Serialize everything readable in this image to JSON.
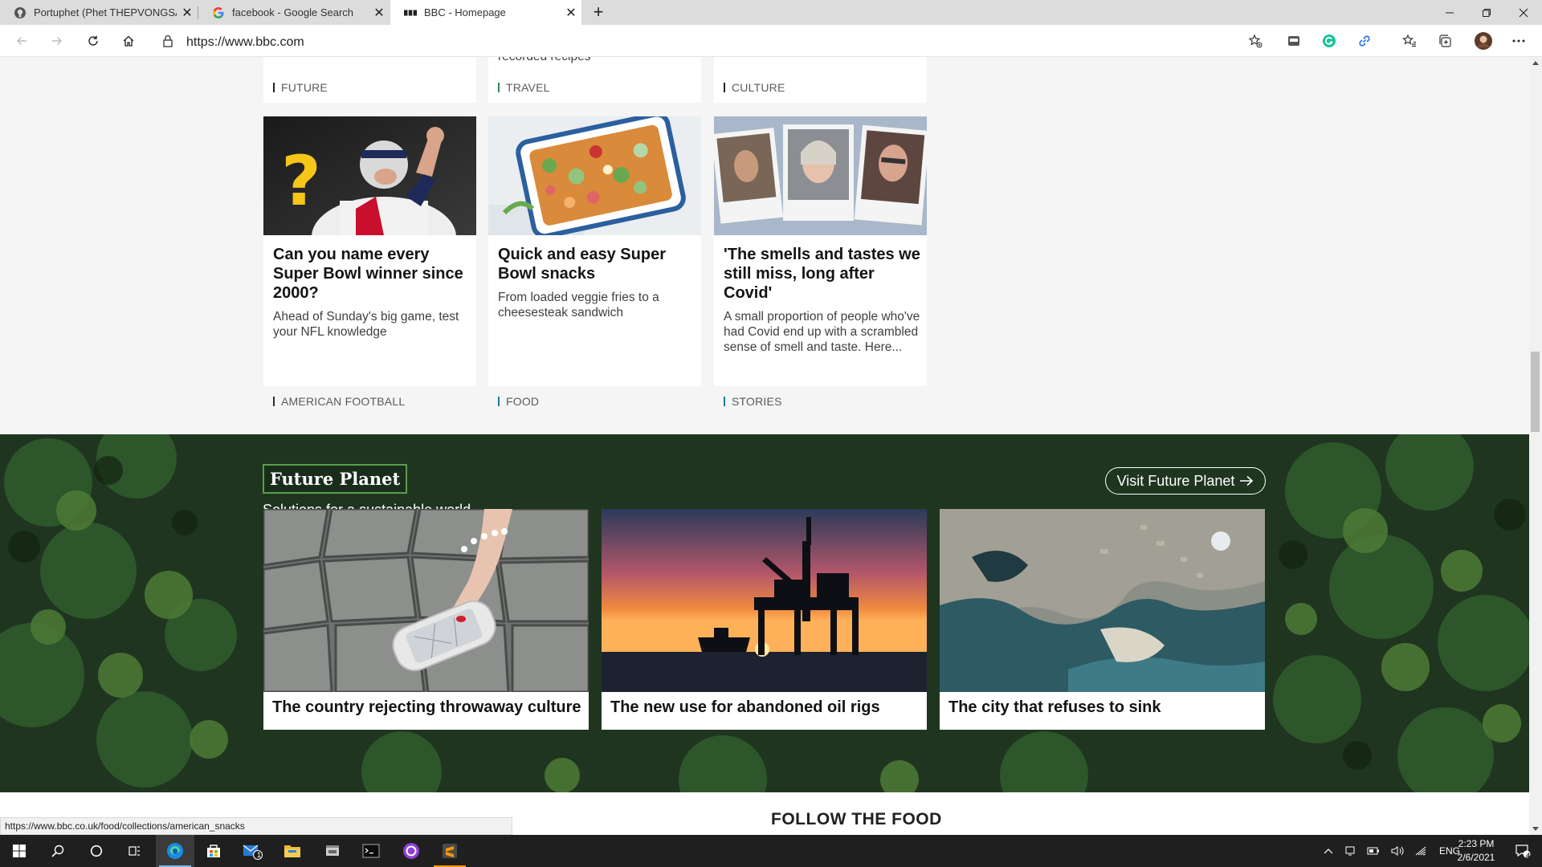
{
  "browser": {
    "tabs": [
      {
        "title": "Portuphet (Phet THEPVONGSA)",
        "icon": "github-icon"
      },
      {
        "title": "facebook - Google Search",
        "icon": "google-icon"
      },
      {
        "title": "BBC - Homepage",
        "icon": "bbc-icon"
      }
    ],
    "close_glyph": "✕",
    "url": "https://www.bbc.com"
  },
  "top_cards": {
    "partial_text": "recorded recipes",
    "tags_above": [
      "FUTURE",
      "TRAVEL",
      "CULTURE"
    ]
  },
  "cards": [
    {
      "title": "Can you name every Super Bowl winner since 2000?",
      "summary": "Ahead of Sunday's big game, test your NFL knowledge",
      "tag": "AMERICAN FOOTBALL",
      "tag_color": "#2b2b2b"
    },
    {
      "title": "Quick and easy Super Bowl snacks",
      "summary": "From loaded veggie fries to a cheesesteak sandwich",
      "tag": "FOOD",
      "tag_color": "#1f7a96"
    },
    {
      "title": "'The smells and tastes we still miss, long after Covid'",
      "summary": "A small proportion of people who've had Covid end up with a scrambled sense of smell and taste. Here...",
      "tag": "STORIES",
      "tag_color": "#1f7a96"
    }
  ],
  "future_planet": {
    "title": "Future Planet",
    "subtitle": "Solutions for a sustainable world",
    "visit_label": "Visit Future Planet",
    "items": [
      {
        "caption": "The country rejecting throwaway culture"
      },
      {
        "caption": "The new use for abandoned oil rigs"
      },
      {
        "caption": "The city that refuses to sink"
      }
    ]
  },
  "follow": {
    "title": "FOLLOW THE FOOD"
  },
  "status_url": "https://www.bbc.co.uk/food/collections/american_snacks",
  "taskbar": {
    "lang": "ENG",
    "time": "2:23 PM",
    "date": "2/6/2021",
    "notifications": "4",
    "mail_badge": "1"
  }
}
